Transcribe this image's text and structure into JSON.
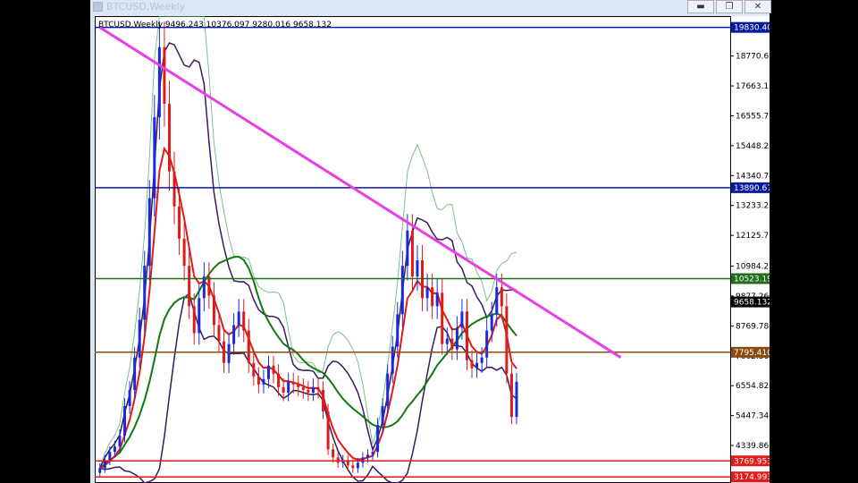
{
  "window": {
    "title": "BTCUSD,Weekly",
    "buttons": [
      {
        "name": "minimize",
        "glyph": "▬"
      },
      {
        "name": "restore",
        "glyph": "❐"
      },
      {
        "name": "close",
        "glyph": "✕"
      }
    ]
  },
  "chart_data": {
    "type": "candlestick",
    "symbol": "BTCUSD,Weekly",
    "ohlc_header": "9496.243 10376.097 9280.016 9658.132",
    "current_price": "9658.132",
    "y_range": [
      2950,
      20250
    ],
    "y_ticks": [
      "18770.660",
      "17663.180",
      "16555.700",
      "15448.220",
      "14340.740",
      "13233.260",
      "12125.780",
      "10984.270",
      "9877.260",
      "8769.780",
      "7662.300",
      "6554.820",
      "5447.340",
      "4339.860"
    ],
    "horizontal_levels": [
      {
        "value": 19830.406,
        "label": "19830.406",
        "color": "#0a1a9e"
      },
      {
        "value": 13890.676,
        "label": "13890.676",
        "color": "#0a1a9e"
      },
      {
        "value": 10523.195,
        "label": "10523.195",
        "color": "#1e6e1e"
      },
      {
        "value": 7795.41,
        "label": "7795.410",
        "color": "#8a4a12"
      },
      {
        "value": 3769.953,
        "label": "3769.953",
        "color": "#e21a1a"
      },
      {
        "value": 3174.993,
        "label": "3174.993",
        "color": "#e21a1a"
      }
    ],
    "trendline": {
      "start_week": 0,
      "start_value": 19830,
      "end_week": 105,
      "end_value": 7600,
      "color": "#e640e0"
    },
    "bars": 85,
    "colors": {
      "up": "#1a2ad8",
      "down": "#e01a1a",
      "ema_fast": "#e01a1a",
      "ma_slow": "#0e7a0e",
      "envelope": "#3a1a5e",
      "bollinger": "#7ac28a",
      "price_tag_bg": "#000"
    },
    "closes": [
      3500,
      3800,
      4100,
      4300,
      4700,
      5800,
      6400,
      7600,
      9000,
      11000,
      13500,
      16500,
      19100,
      17000,
      14500,
      13200,
      12000,
      11000,
      9500,
      8500,
      9800,
      10600,
      9900,
      8800,
      8200,
      7400,
      8100,
      8800,
      9300,
      8600,
      7400,
      6900,
      6600,
      6800,
      7300,
      7000,
      6500,
      6300,
      6700,
      6600,
      6500,
      6400,
      6300,
      6500,
      6400,
      5600,
      4200,
      3900,
      3700,
      3800,
      3600,
      3500,
      3700,
      3900,
      4000,
      4100,
      5100,
      5800,
      7000,
      8000,
      9200,
      11000,
      12300,
      10600,
      11200,
      9800,
      10200,
      9500,
      10000,
      8100,
      8300,
      7900,
      8700,
      9300,
      7500,
      7200,
      7400,
      7600,
      8600,
      9200,
      10200,
      9500,
      7000,
      5400,
      6700
    ]
  }
}
